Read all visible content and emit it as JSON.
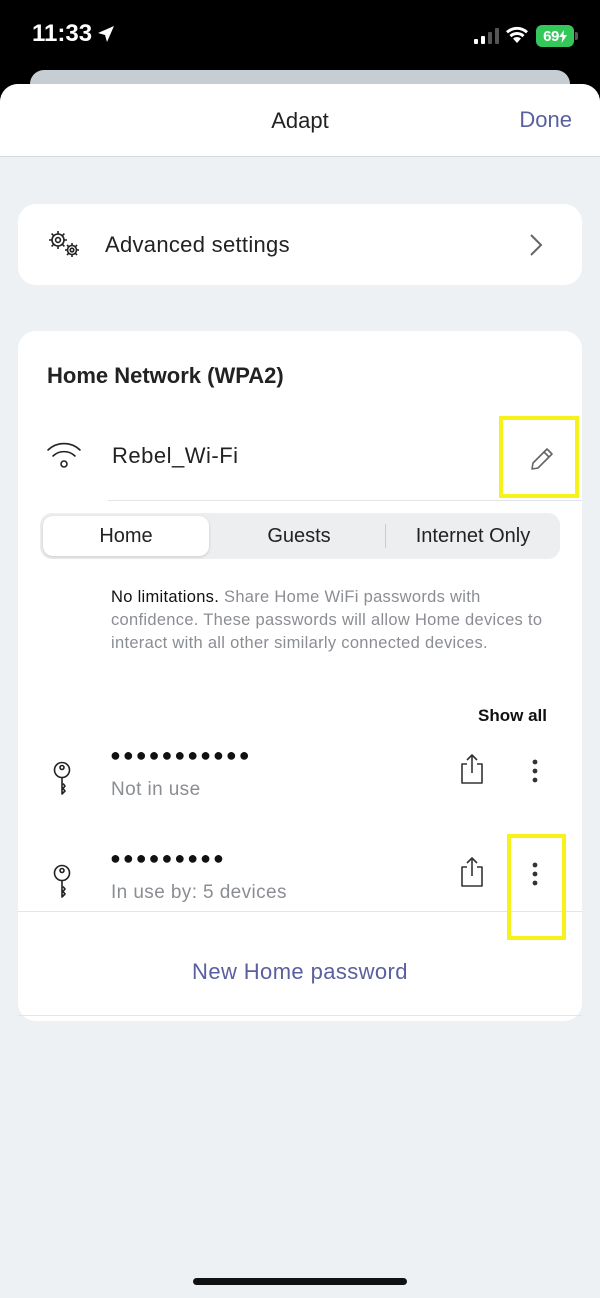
{
  "status_bar": {
    "time": "11:33",
    "battery": "69",
    "icons": [
      "location-arrow-icon",
      "cellular-signal-icon",
      "wifi-icon",
      "battery-charging-icon"
    ]
  },
  "nav": {
    "title": "Adapt",
    "done_label": "Done"
  },
  "advanced": {
    "label": "Advanced settings",
    "icon": "gears-icon"
  },
  "network": {
    "title": "Home Network (WPA2)",
    "ssid": "Rebel_Wi-Fi",
    "tabs": [
      {
        "label": "Home",
        "selected": true
      },
      {
        "label": "Guests",
        "selected": false
      },
      {
        "label": "Internet Only",
        "selected": false
      }
    ],
    "description_strong": "No limitations.",
    "description": " Share Home WiFi passwords with confidence. These passwords will allow Home devices to interact with all other similarly connected devices.",
    "show_all_label": "Show all",
    "passwords": [
      {
        "masked": "●●●●●●●●●●●",
        "status": "Not in use"
      },
      {
        "masked": "●●●●●●●●●",
        "status": "In use by: 5 devices"
      }
    ],
    "new_password_label": "New Home password"
  },
  "colors": {
    "accent": "#5a5fa0",
    "highlight": "#f7f21a",
    "background": "#eef1f3",
    "battery": "#34c759"
  }
}
